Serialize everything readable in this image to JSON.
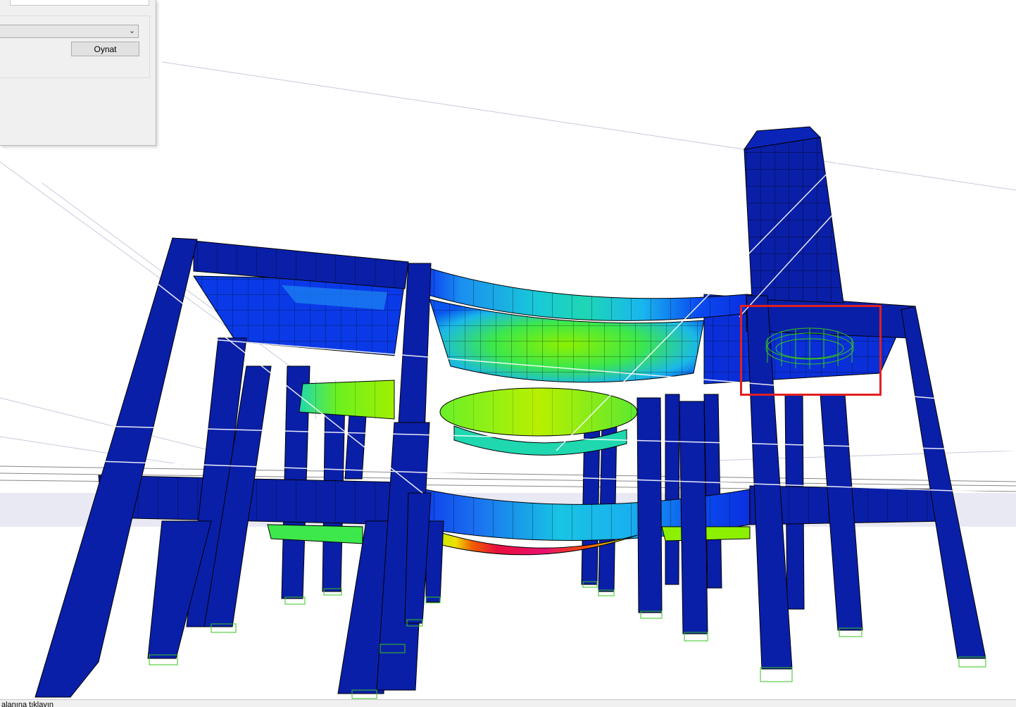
{
  "dialog": {
    "top_input_value": "",
    "combo_value": "",
    "play_button_label": "Oynat"
  },
  "status_bar": {
    "text": "alanına tıklayın"
  },
  "colors": {
    "frame_blue": "#0a1fa8",
    "bright_blue": "#0a33f0",
    "cyan": "#19b6ef",
    "teal": "#1bd7c8",
    "green": "#4cf020",
    "yellow_green": "#a8f000",
    "hotspot_red": "#e8103c",
    "selection_red": "#e02020",
    "wire_green": "#36c41c"
  },
  "icons": {
    "combo_arrow": "chevron-down-icon"
  }
}
